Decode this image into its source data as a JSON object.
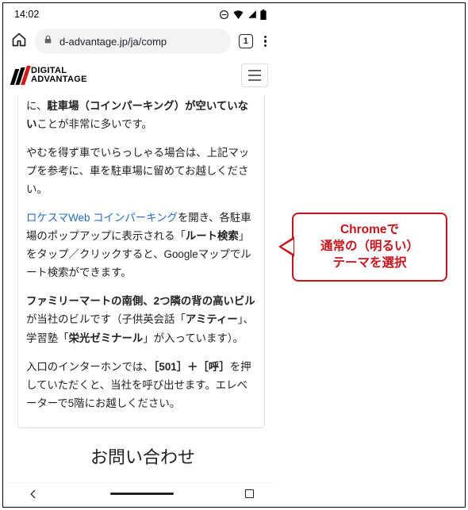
{
  "statusbar": {
    "time": "14:02"
  },
  "chrome": {
    "url": "d-advantage.jp/ja/comp",
    "tab_count": "1"
  },
  "logo": {
    "line1": "DIGITAL",
    "line2": "ADVANTAGE"
  },
  "content": {
    "p1_pre": "に、",
    "p1_bold": "駐車場（コインパーキング）が空いていない",
    "p1_post": "ことが非常に多いです。",
    "p2": "やむを得ず車でいらっしゃる場合は、上記マップを参考に、車を駐車場に留めてお越しください。",
    "p3_link": "ロケスマWeb コインパーキング",
    "p3_a": "を開き、各駐車場のポップアップに表示される「",
    "p3_bold": "ルート検索",
    "p3_b": "」をタップ／クリックすると、Googleマップでルート検索ができます。",
    "p4_b1": "ファミリーマートの南側、2つ隣の背の高いビル",
    "p4_a": "が当社のビルです（子供英会話「",
    "p4_b2": "アミティー",
    "p4_b": "」、学習塾「",
    "p4_b3": "栄光ゼミナール",
    "p4_c": "」が入っています）。",
    "p5_a": "入口のインターホンでは、",
    "p5_b1": "［501］＋［呼］",
    "p5_b": "を押していただくと、当社を呼び出せます。エレベーターで5階にお越しください。",
    "heading": "お問い合わせ"
  },
  "callout": {
    "l1": "Chromeで",
    "l2": "通常の（明るい）",
    "l3": "テーマを選択"
  }
}
